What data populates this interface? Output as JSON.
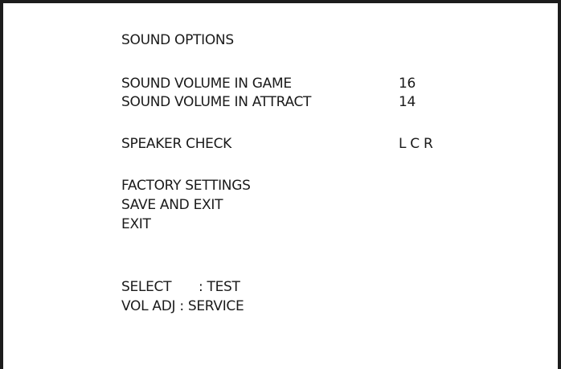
{
  "menu": {
    "title": "SOUND OPTIONS",
    "items": [
      {
        "label": "SOUND VOLUME IN GAME",
        "value": "16"
      },
      {
        "label": "SOUND VOLUME IN ATTRACT",
        "value": "14"
      },
      {
        "label": "SPEAKER CHECK",
        "value": "L C R"
      },
      {
        "label": "FACTORY SETTINGS"
      },
      {
        "label": "SAVE AND EXIT"
      },
      {
        "label": "EXIT"
      }
    ]
  },
  "controls": {
    "select": {
      "key": "SELECT",
      "action": ": TEST"
    },
    "vol_adj": {
      "key": "VOL ADJ",
      "action": ": SERVICE"
    }
  }
}
